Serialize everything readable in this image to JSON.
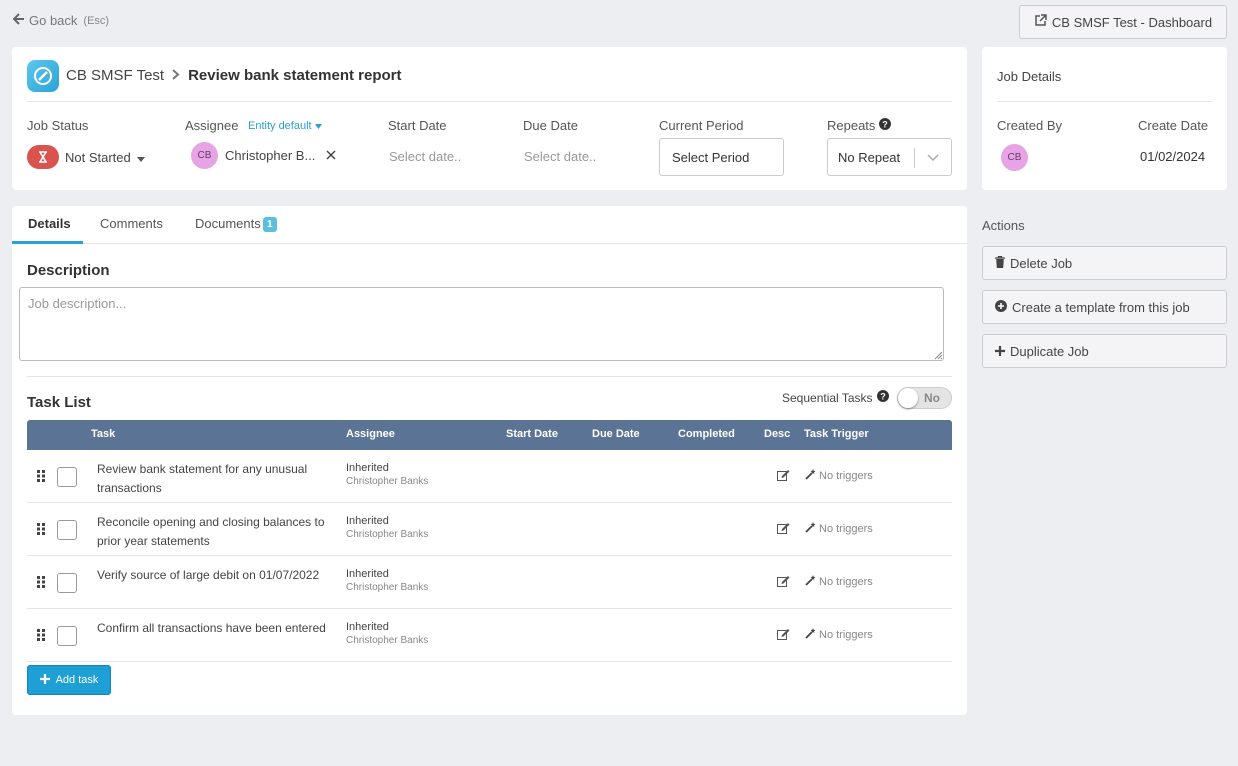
{
  "topbar": {
    "go_back": "Go back",
    "esc_hint": "(Esc)",
    "dashboard_button": "CB SMSF Test - Dashboard"
  },
  "header": {
    "org_name": "CB SMSF Test",
    "job_title": "Review bank statement report",
    "job_status_label": "Job Status",
    "job_status_value": "Not Started",
    "assignee_label": "Assignee",
    "entity_default": "Entity default",
    "assignee_initials": "CB",
    "assignee_name": "Christopher B...",
    "start_date_label": "Start Date",
    "start_date_placeholder": "Select date..",
    "due_date_label": "Due Date",
    "due_date_placeholder": "Select date..",
    "current_period_label": "Current Period",
    "current_period_value": "Select Period",
    "repeats_label": "Repeats",
    "repeats_value": "No Repeat"
  },
  "job_details": {
    "title": "Job Details",
    "created_by_label": "Created By",
    "created_by_initials": "CB",
    "create_date_label": "Create Date",
    "create_date_value": "01/02/2024"
  },
  "tabs": [
    {
      "label": "Details"
    },
    {
      "label": "Comments"
    },
    {
      "label": "Documents",
      "badge": "1"
    }
  ],
  "description": {
    "title": "Description",
    "placeholder": "Job description..."
  },
  "task_list": {
    "title": "Task List",
    "sequential_label": "Sequential Tasks",
    "sequential_value": "No",
    "columns": [
      "Task",
      "Assignee",
      "Start Date",
      "Due Date",
      "Completed",
      "Desc",
      "Task Trigger"
    ],
    "rows": [
      {
        "task": "Review bank statement for any unusual transactions",
        "assignee_type": "Inherited",
        "assignee_name": "Christopher Banks",
        "trigger": "No triggers"
      },
      {
        "task": "Reconcile opening and closing balances to prior year statements",
        "assignee_type": "Inherited",
        "assignee_name": "Christopher Banks",
        "trigger": "No triggers"
      },
      {
        "task": "Verify source of large debit on 01/07/2022",
        "assignee_type": "Inherited",
        "assignee_name": "Christopher Banks",
        "trigger": "No triggers"
      },
      {
        "task": "Confirm all transactions have been entered",
        "assignee_type": "Inherited",
        "assignee_name": "Christopher Banks",
        "trigger": "No triggers"
      }
    ],
    "add_task": "Add task"
  },
  "actions": {
    "title": "Actions",
    "delete_job": "Delete Job",
    "create_template": "Create a template from this job",
    "duplicate_job": "Duplicate Job"
  },
  "colors": {
    "accent": "#2b9fd6",
    "table_header": "#5b7394",
    "status_red": "#d9534f",
    "avatar_pink": "#e6a3e6"
  }
}
